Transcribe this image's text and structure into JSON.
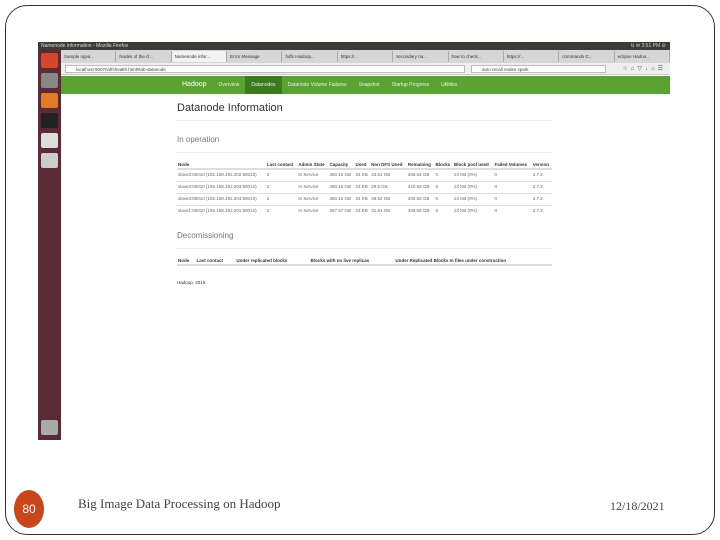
{
  "window_title": "Namenode information - Mozilla Firefox",
  "tray": "⇅ ✉ 3:51 PM ⚙",
  "tabs": [
    "Sample ngva...",
    "Nodes of the cl...",
    "Namenode infor...",
    "Error Message",
    "hdfs Hadoop...",
    "https://...",
    "secondary na...",
    "how to check...",
    "https://...",
    "commands C...",
    "eclipse Hadoo..."
  ],
  "url": "localhost:50070/dfshealth.html#tab-datanode",
  "search": "auto recall nodes spark",
  "nav": {
    "brand": "Hadoop",
    "items": [
      "Overview",
      "Datanodes",
      "Datanode Volume Failures",
      "Snapshot",
      "Startup Progress",
      "Utilities"
    ]
  },
  "page_title": "Datanode Information",
  "in_operation": {
    "heading": "In operation",
    "columns": [
      "Node",
      "Last contact",
      "Admin State",
      "Capacity",
      "Used",
      "Non DFS Used",
      "Remaining",
      "Blocks",
      "Block pool used",
      "Failed Volumes",
      "Version"
    ],
    "rows": [
      [
        "slave2:50010 (192.168.192.202:50010)",
        "2",
        "In Service",
        "450.15 GB",
        "24 KB",
        "43.51 GB",
        "406.64 GB",
        "0",
        "24 KB (0%)",
        "0",
        "2.7.2"
      ],
      [
        "slave3:50010 (192.168.192.203:50010)",
        "2",
        "In Service",
        "450.15 GB",
        "24 KB",
        "29.5 GB",
        "420.65 GB",
        "0",
        "24 KB (0%)",
        "0",
        "2.7.2"
      ],
      [
        "slave4:50010 (192.168.192.204:50010)",
        "2",
        "In Service",
        "450.15 GB",
        "24 KB",
        "49.52 GB",
        "400.63 GB",
        "0",
        "24 KB (0%)",
        "0",
        "2.7.2"
      ],
      [
        "slave1:50010 (192.168.192.201:50010)",
        "2",
        "In Service",
        "367.87 GB",
        "24 KB",
        "31.81 GB",
        "335.06 GB",
        "0",
        "24 KB (0%)",
        "0",
        "2.7.2"
      ]
    ]
  },
  "decommissioning": {
    "heading": "Decomissioning",
    "columns": [
      "Node",
      "Last contact",
      "Under replicated blocks",
      "Blocks with no live replicas",
      "Under Replicated Blocks In files under construction"
    ]
  },
  "page_footer": "Hadoop, 2015.",
  "slide": {
    "number": "80",
    "title": "Big Image Data Processing on Hadoop",
    "date": "12/18/2021",
    "accent": "#c8461c"
  }
}
